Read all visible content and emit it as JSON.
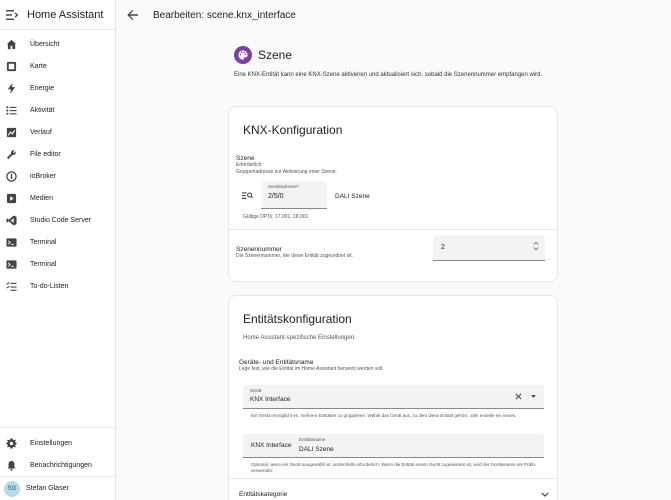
{
  "sidebar": {
    "title": "Home Assistant",
    "items": [
      {
        "label": "Übersicht",
        "icon": "grid-icon"
      },
      {
        "label": "Karte",
        "icon": "map-icon"
      },
      {
        "label": "Energie",
        "icon": "lightning-icon"
      },
      {
        "label": "Aktivität",
        "icon": "list-icon"
      },
      {
        "label": "Verlauf",
        "icon": "chart-icon"
      },
      {
        "label": "File editor",
        "icon": "wrench-icon"
      },
      {
        "label": "ioBroker",
        "icon": "iobroker-icon"
      },
      {
        "label": "Medien",
        "icon": "play-icon"
      },
      {
        "label": "Studio Code Server",
        "icon": "vscode-icon"
      },
      {
        "label": "Terminal",
        "icon": "terminal-icon"
      },
      {
        "label": "Terminal",
        "icon": "terminal-icon"
      },
      {
        "label": "To-do-Listen",
        "icon": "checklist-icon"
      }
    ],
    "bottom": [
      {
        "label": "Einstellungen",
        "icon": "gear-icon"
      },
      {
        "label": "Benachrichtigungen",
        "icon": "bell-icon"
      }
    ],
    "user": {
      "initials": "SG",
      "name": "Stefan Glaser"
    }
  },
  "header": {
    "title": "Bearbeiten: scene.knx_interface"
  },
  "scene": {
    "title": "Szene",
    "description": "Eine KNX-Entität kann eine KNX-Szene aktivieren und aktualisiert sich, sobald die Szenennummer empfangen wird."
  },
  "knx_config": {
    "title": "KNX-Konfiguration",
    "szene_label": "Szene",
    "required": "Erforderlich",
    "group_address_desc": "Gruppenadresse zur Aktivierung einer Szene.",
    "send_address_label": "Sendeadresse*",
    "send_address_value": "2/5/0",
    "address_name": "DALI Szene",
    "valid_dpts": "Gültige DPTs: 17.001, 18.001",
    "scene_number_label": "Szenennummer",
    "scene_number_desc": "Die Szenennummer, der diese Entität zugeordnet ist.",
    "scene_number_value": "2"
  },
  "entity_config": {
    "title": "Entitätskonfiguration",
    "subtitle": "Home Assistant-spezifische Einstellungen.",
    "device_entity_label": "Geräte- und Entitätsname",
    "device_entity_desc": "Lege fest, wie die Entität im Home Assistant benannt werden soll.",
    "device_field_label": "Gerät",
    "device_field_value": "KNX Interface",
    "device_help": "Ein Gerät ermöglicht es, mehrere Entitäten zu gruppieren. Wähle das Gerät aus, zu dem diese Entität gehört, oder erstelle ein neues.",
    "entity_prefix": "KNX Interface",
    "entity_name_label": "Entitätsname",
    "entity_name_value": "DALI Szene",
    "entity_help": "Optional, wenn ein Gerät ausgewählt ist, andernfalls erforderlich. Wenn die Entität einem Gerät zugewiesen ist, wird der Gerätename als Präfix verwendet.",
    "category_label": "Entitätskategorie"
  },
  "colors": {
    "accent": "#7b3fa5",
    "avatar_bg": "#b5dce8"
  }
}
